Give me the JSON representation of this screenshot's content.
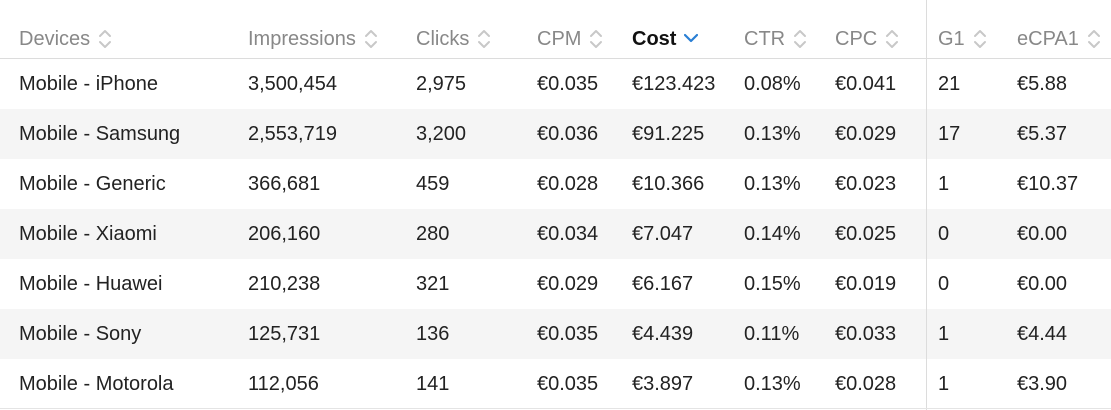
{
  "columns": [
    {
      "label": "Devices",
      "sort": "none"
    },
    {
      "label": "Impressions",
      "sort": "none"
    },
    {
      "label": "Clicks",
      "sort": "none"
    },
    {
      "label": "CPM",
      "sort": "none"
    },
    {
      "label": "Cost",
      "sort": "desc"
    },
    {
      "label": "CTR",
      "sort": "none"
    },
    {
      "label": "CPC",
      "sort": "none"
    },
    {
      "label": "G1",
      "sort": "none"
    },
    {
      "label": "eCPA1",
      "sort": "none"
    }
  ],
  "rows": [
    [
      "Mobile - iPhone",
      "3,500,454",
      "2,975",
      "€0.035",
      "€123.423",
      "0.08%",
      "€0.041",
      "21",
      "€5.88"
    ],
    [
      "Mobile - Samsung",
      "2,553,719",
      "3,200",
      "€0.036",
      "€91.225",
      "0.13%",
      "€0.029",
      "17",
      "€5.37"
    ],
    [
      "Mobile - Generic",
      "366,681",
      "459",
      "€0.028",
      "€10.366",
      "0.13%",
      "€0.023",
      "1",
      "€10.37"
    ],
    [
      "Mobile - Xiaomi",
      "206,160",
      "280",
      "€0.034",
      "€7.047",
      "0.14%",
      "€0.025",
      "0",
      "€0.00"
    ],
    [
      "Mobile - Huawei",
      "210,238",
      "321",
      "€0.029",
      "€6.167",
      "0.15%",
      "€0.019",
      "0",
      "€0.00"
    ],
    [
      "Mobile - Sony",
      "125,731",
      "136",
      "€0.035",
      "€4.439",
      "0.11%",
      "€0.033",
      "1",
      "€4.44"
    ],
    [
      "Mobile - Motorola",
      "112,056",
      "141",
      "€0.035",
      "€3.897",
      "0.13%",
      "€0.028",
      "1",
      "€3.90"
    ]
  ],
  "colors": {
    "header_text": "#888888",
    "header_active_text": "#111111",
    "sort_active": "#2a7fd4",
    "sort_inactive": "#c8c8c8",
    "row_stripe": "#f5f5f5"
  }
}
